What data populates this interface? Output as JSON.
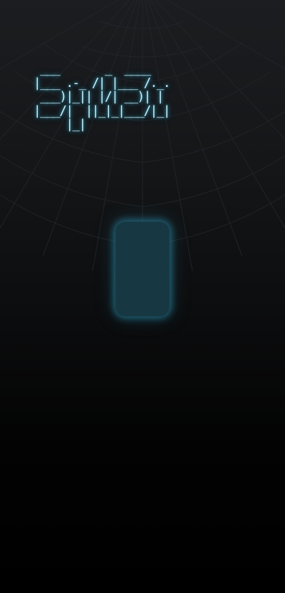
{
  "app": {
    "logo_text": " ___       _  ____\n|___ .-_ /| |___ /._.\n ___)|_|| |/| __)| |\n|___/|  ||_|_|___/|_|\n     |_|",
    "colors": {
      "logo_glow": "#3fc3e6",
      "logo_text": "#c9f2ff",
      "button_fill": "#173843",
      "background_top": "#1b1d20",
      "background_bottom": "#000000"
    }
  },
  "play_button": {
    "icon": "rounded-rectangle"
  }
}
